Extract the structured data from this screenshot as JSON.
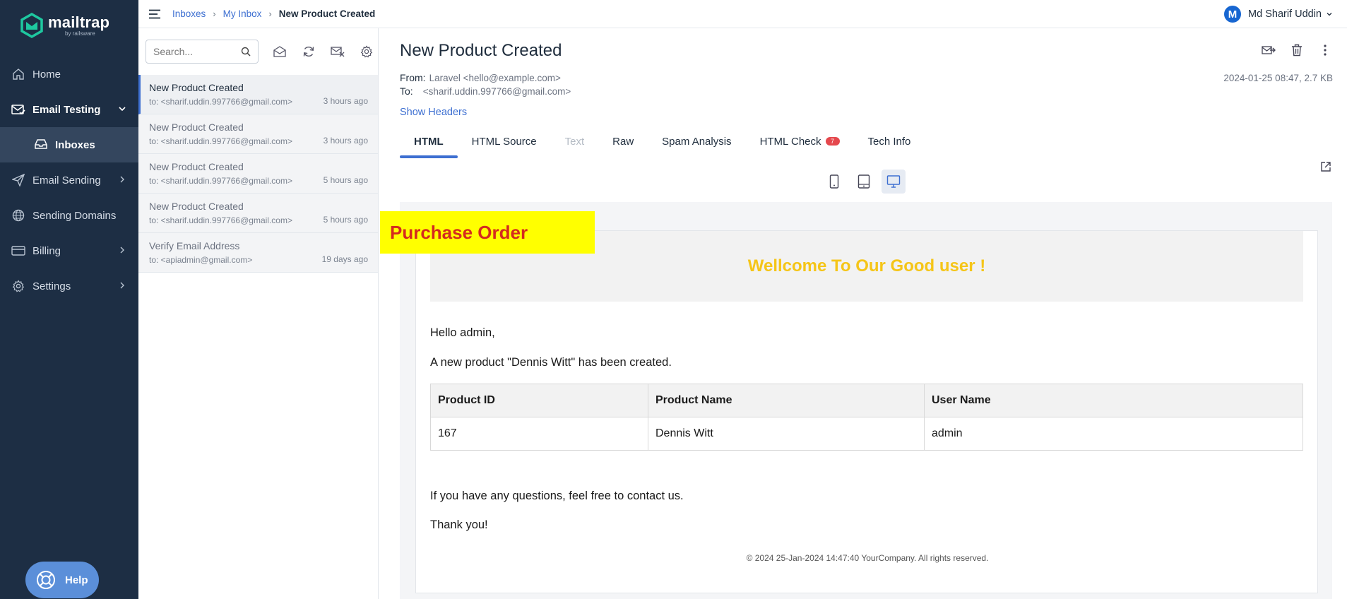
{
  "app": {
    "logo_text": "mailtrap",
    "logo_sub": "by railsware"
  },
  "sidebar": {
    "items": [
      {
        "label": "Home",
        "icon": "home-icon"
      },
      {
        "label": "Email Testing",
        "icon": "email-testing-icon"
      },
      {
        "label": "Inboxes",
        "icon": "inbox-icon"
      },
      {
        "label": "Email Sending",
        "icon": "send-icon"
      },
      {
        "label": "Sending Domains",
        "icon": "globe-icon"
      },
      {
        "label": "Billing",
        "icon": "billing-icon"
      },
      {
        "label": "Settings",
        "icon": "gear-icon"
      }
    ],
    "help_label": "Help"
  },
  "topbar": {
    "breadcrumb": [
      "Inboxes",
      "My Inbox",
      "New Product Created"
    ],
    "user_initial": "M",
    "user_name": "Md Sharif Uddin"
  },
  "list": {
    "search_placeholder": "Search...",
    "messages": [
      {
        "subject": "New Product Created",
        "to": "to: <sharif.uddin.997766@gmail.com>",
        "time": "3 hours ago"
      },
      {
        "subject": "New Product Created",
        "to": "to: <sharif.uddin.997766@gmail.com>",
        "time": "3 hours ago"
      },
      {
        "subject": "New Product Created",
        "to": "to: <sharif.uddin.997766@gmail.com>",
        "time": "5 hours ago"
      },
      {
        "subject": "New Product Created",
        "to": "to: <sharif.uddin.997766@gmail.com>",
        "time": "5 hours ago"
      },
      {
        "subject": "Verify Email Address",
        "to": "to: <apiadmin@gmail.com>",
        "time": "19 days ago"
      }
    ]
  },
  "detail": {
    "subject": "New Product Created",
    "from_label": "From:",
    "from_value": "Laravel <hello@example.com>",
    "to_label": "To:",
    "to_value": "<sharif.uddin.997766@gmail.com>",
    "meta": "2024-01-25 08:47, 2.7 KB",
    "show_headers": "Show Headers",
    "tabs": [
      {
        "label": "HTML"
      },
      {
        "label": "HTML Source"
      },
      {
        "label": "Text"
      },
      {
        "label": "Raw"
      },
      {
        "label": "Spam Analysis"
      },
      {
        "label": "HTML Check",
        "badge": "7"
      },
      {
        "label": "Tech Info"
      }
    ]
  },
  "email": {
    "banner": "Wellcome To Our Good user !",
    "greeting": "Hello admin,",
    "intro": "A new product \"Dennis Witt\" has been created.",
    "table": {
      "headers": [
        "Product ID",
        "Product Name",
        "User Name"
      ],
      "row": [
        "167",
        "Dennis Witt",
        "admin"
      ]
    },
    "closing": "If you have any questions, feel free to contact us.",
    "thanks": "Thank you!",
    "footer": "© 2024 25-Jan-2024 14:47:40 YourCompany. All rights reserved."
  },
  "overlay": {
    "text": "Purchase Order"
  },
  "colors": {
    "sidebar_bg": "#1d2e44",
    "accent": "#3d6fd1",
    "banner_text": "#f5c518",
    "overlay_bg": "#ffff00",
    "overlay_text": "#d42a1f",
    "badge": "#e5484d"
  }
}
